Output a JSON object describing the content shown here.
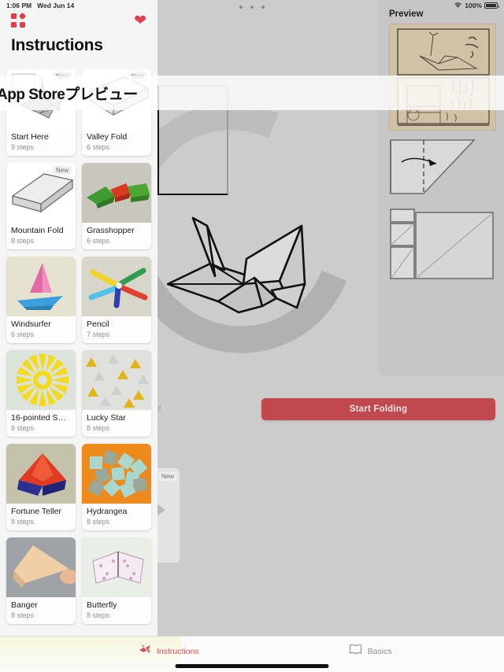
{
  "status_bar": {
    "time": "1:06 PM",
    "date": "Wed Jun 14",
    "wifi_icon": "wifi-icon",
    "battery_percent": "100%"
  },
  "overlay": {
    "text": "App Storeプレビュー"
  },
  "sidebar": {
    "grid_icon": "grid-icon",
    "favorite_icon": "heart-icon",
    "title": "Instructions",
    "badge_new": "New",
    "cards": [
      {
        "title": "Start Here",
        "steps": "9 steps",
        "new": true,
        "thumb": "crane-sketch"
      },
      {
        "title": "Valley Fold",
        "steps": "6 steps",
        "new": true,
        "thumb": "valley-fold-sketch"
      },
      {
        "title": "Mountain Fold",
        "steps": "8 steps",
        "new": true,
        "thumb": "mountain-fold-sketch"
      },
      {
        "title": "Grasshopper",
        "steps": "6 steps",
        "new": false,
        "thumb": "grasshopper-photo"
      },
      {
        "title": "Windsurfer",
        "steps": "6 steps",
        "new": false,
        "thumb": "windsurfer-photo"
      },
      {
        "title": "Pencil",
        "steps": "7 steps",
        "new": false,
        "thumb": "pencil-photo"
      },
      {
        "title": "16-pointed S…",
        "steps": "8 steps",
        "new": false,
        "thumb": "sixteen-point-star-photo"
      },
      {
        "title": "Lucky Star",
        "steps": "8 steps",
        "new": false,
        "thumb": "lucky-star-photo"
      },
      {
        "title": "Fortune Teller",
        "steps": "8 steps",
        "new": false,
        "thumb": "fortune-teller-photo"
      },
      {
        "title": "Hydrangea",
        "steps": "8 steps",
        "new": false,
        "thumb": "hydrangea-photo"
      },
      {
        "title": "Banger",
        "steps": "8 steps",
        "new": false,
        "thumb": "banger-photo"
      },
      {
        "title": "Butterfly",
        "steps": "8 steps",
        "new": false,
        "thumb": "butterfly-photo"
      }
    ]
  },
  "preview_panel": {
    "title": "Preview",
    "document_thumb": "japanese-origami-manuscript",
    "diagram_one": "fold-step-diagram-triangle",
    "diagram_two": "fold-step-diagram-grid"
  },
  "main": {
    "start_folding_label": "Start Folding",
    "ghost_text": "le",
    "ghost_badge": "New",
    "drag_handle": "drag-handle-dots"
  },
  "tab_bar": {
    "tabs": [
      {
        "label": "Instructions",
        "icon": "crane-icon",
        "active": true
      },
      {
        "label": "Basics",
        "icon": "book-icon",
        "active": false
      }
    ]
  },
  "colors": {
    "accent_red": "#e0404c",
    "button_red": "#c24850",
    "tab_active": "#d4545c",
    "tab_inactive": "#8e8e8e",
    "main_bg": "#cccccc",
    "sidebar_bg": "#f5f5f5",
    "preview_bg": "#c6c6c6"
  }
}
